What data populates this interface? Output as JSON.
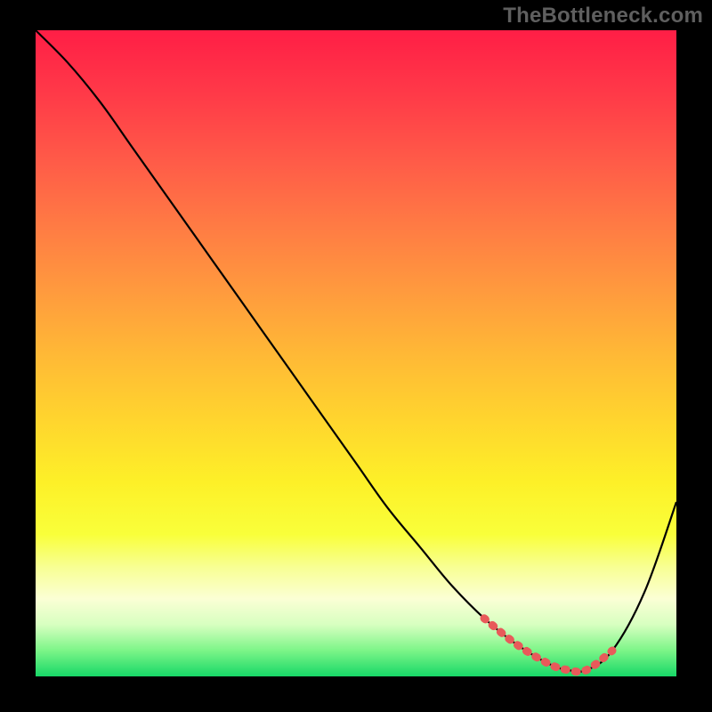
{
  "watermark": "TheBottleneck.com",
  "chart_data": {
    "type": "line",
    "title": "",
    "xlabel": "",
    "ylabel": "",
    "xlim": [
      0,
      100
    ],
    "ylim": [
      0,
      100
    ],
    "grid": false,
    "legend": false,
    "series": [
      {
        "name": "bottleneck-curve",
        "color": "#000000",
        "x": [
          0,
          5,
          10,
          15,
          20,
          25,
          30,
          35,
          40,
          45,
          50,
          55,
          60,
          65,
          70,
          75,
          80,
          83,
          86,
          90,
          95,
          100
        ],
        "y": [
          100,
          95,
          89,
          82,
          75,
          68,
          61,
          54,
          47,
          40,
          33,
          26,
          20,
          14,
          9,
          5,
          2,
          1,
          1,
          4,
          13,
          27
        ]
      },
      {
        "name": "valley-highlight",
        "color": "#e85a5a",
        "x": [
          70,
          75,
          80,
          83,
          86,
          90
        ],
        "y": [
          9,
          5,
          2,
          1,
          1,
          4
        ]
      }
    ],
    "background_gradient": {
      "top": "#ff1e46",
      "mid": "#ffd42e",
      "bottom": "#17d867"
    }
  }
}
